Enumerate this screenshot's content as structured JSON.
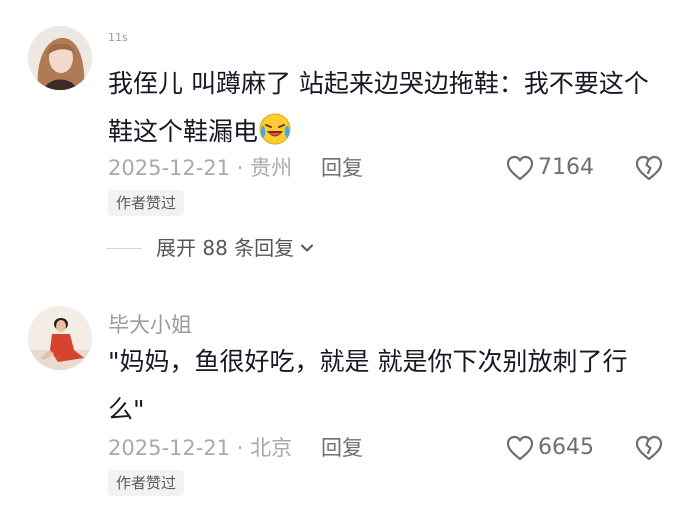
{
  "comments": [
    {
      "author": "11s",
      "text": "我侄儿 叫蹲麻了 站起来边哭边拖鞋：我不要这个鞋这个鞋漏电",
      "emoji": "crying-laughing-emoji",
      "meta": "2025-12-21 · 贵州",
      "reply_label": "回复",
      "likes": "7164",
      "badge": "作者赞过",
      "expand_label": "展开 88 条回复"
    },
    {
      "author": "毕大小姐",
      "text": "\"妈妈，鱼很好吃，就是 就是你下次别放刺了行么\"",
      "meta": "2025-12-21 · 北京",
      "reply_label": "回复",
      "likes": "6645",
      "badge": "作者赞过"
    }
  ],
  "colors": {
    "text": "#161823",
    "meta": "#a8a9ad",
    "action": "#6e6f76",
    "badge_bg": "#f2f2f3"
  }
}
